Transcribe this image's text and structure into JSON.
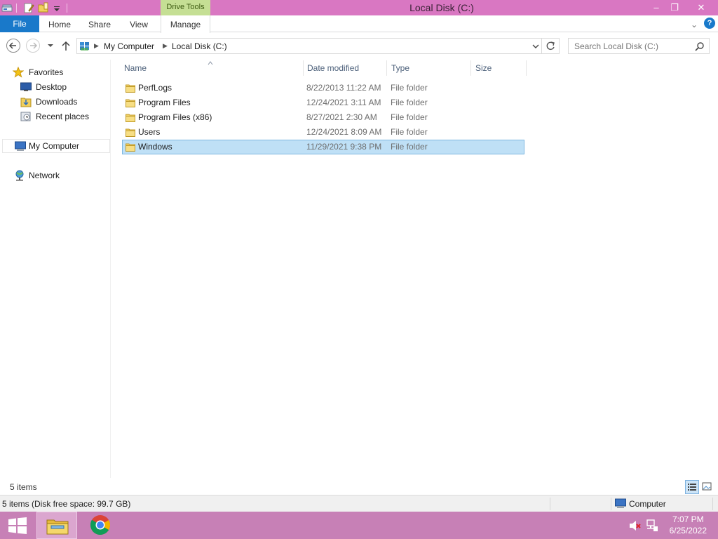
{
  "window": {
    "title": "Local Disk (C:)",
    "context_tab": "Drive Tools",
    "controls": {
      "minimize": "–",
      "restore": "❐",
      "close": "✕"
    }
  },
  "ribbon": {
    "tabs": [
      "File",
      "Home",
      "Share",
      "View",
      "Manage"
    ],
    "help_icon": "?",
    "expand_icon": "⌄"
  },
  "address": {
    "segments": [
      "My Computer",
      "Local Disk (C:)"
    ],
    "search_placeholder": "Search Local Disk (C:)"
  },
  "nav_pane": {
    "favorites": "Favorites",
    "favorite_items": [
      "Desktop",
      "Downloads",
      "Recent places"
    ],
    "my_computer": "My Computer",
    "network": "Network"
  },
  "columns": [
    "Name",
    "Date modified",
    "Type",
    "Size"
  ],
  "files": [
    {
      "name": "PerfLogs",
      "date": "8/22/2013 11:22 AM",
      "type": "File folder"
    },
    {
      "name": "Program Files",
      "date": "12/24/2021 3:11 AM",
      "type": "File folder"
    },
    {
      "name": "Program Files (x86)",
      "date": "8/27/2021 2:30 AM",
      "type": "File folder"
    },
    {
      "name": "Users",
      "date": "12/24/2021 8:09 AM",
      "type": "File folder"
    },
    {
      "name": "Windows",
      "date": "11/29/2021 9:38 PM",
      "type": "File folder",
      "selected": true
    }
  ],
  "status": {
    "item_count": "5 items",
    "details": "5 items (Disk free space: 99.7 GB)",
    "location": "Computer"
  },
  "taskbar": {
    "time": "7:07 PM",
    "date": "6/25/2022"
  },
  "colors": {
    "titlebar": "#d977c2",
    "taskbar": "#c780b6",
    "file_tab": "#1979ca",
    "drive_tools": "#c5df94",
    "selection": "#bfe0f6"
  }
}
